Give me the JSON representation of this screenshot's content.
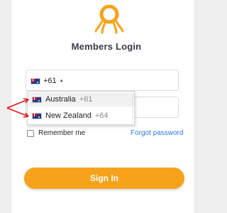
{
  "login": {
    "title": "Members Login",
    "phone": {
      "selected_flag_icon": "australia-flag-icon",
      "selected_dial_code": "+61"
    },
    "dropdown": {
      "options": [
        {
          "country": "Australia",
          "code": "+61",
          "flag_icon": "australia-flag-icon"
        },
        {
          "country": "New Zealand",
          "code": "+64",
          "flag_icon": "new-zealand-flag-icon"
        }
      ]
    },
    "remember_label": "Remember me",
    "forgot_label": "Forgot password",
    "signin_label": "Sign In"
  },
  "colors": {
    "brand": "#f7a21b",
    "link": "#2a7ae2",
    "annotation": "#e3161b"
  }
}
